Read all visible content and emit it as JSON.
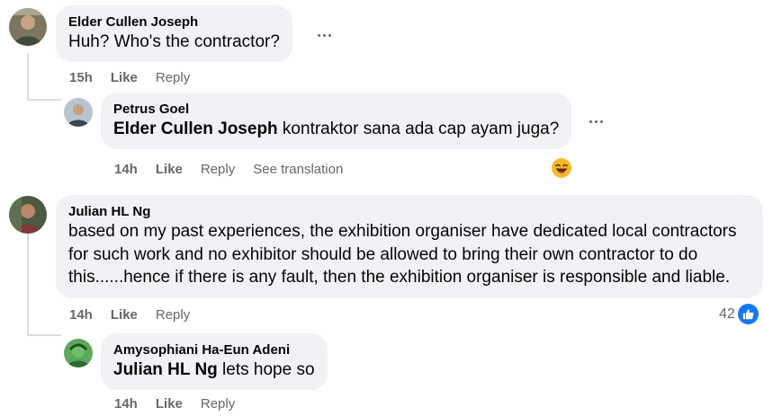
{
  "comments": [
    {
      "author": "Elder Cullen Joseph",
      "text": "Huh? Who's the contractor?",
      "time": "15h",
      "like_label": "Like",
      "reply_label": "Reply"
    },
    {
      "author": "Petrus Goel",
      "mention": "Elder Cullen Joseph",
      "text": " kontraktor sana ada cap ayam juga?",
      "time": "14h",
      "like_label": "Like",
      "reply_label": "Reply",
      "translate_label": "See translation",
      "reaction_icon": "laughing-emoji-icon"
    },
    {
      "author": "Julian HL Ng",
      "text": "based on my past experiences, the exhibition organiser have dedicated local contractors for such work and no exhibitor should be allowed to bring their own contractor to do this......hence if there is any fault, then the exhibition organiser is responsible and liable.",
      "time": "14h",
      "like_label": "Like",
      "reply_label": "Reply",
      "reaction_count": "42",
      "reaction_icon": "thumbs-up-icon"
    },
    {
      "author": "Amysophiani Ha-Eun Adeni",
      "mention": "Julian HL Ng",
      "text": " lets hope so",
      "time": "14h",
      "like_label": "Like",
      "reply_label": "Reply"
    }
  ],
  "colors": {
    "bubble": "#f0f2f5",
    "meta_text": "#65676b",
    "like_blue": "#1877f2"
  }
}
